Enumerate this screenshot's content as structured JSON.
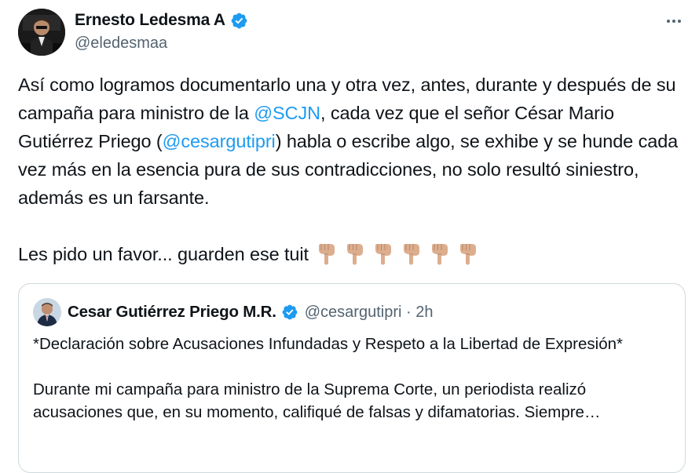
{
  "author": {
    "name": "Ernesto Ledesma A",
    "handle": "@eledesmaa",
    "avatar_icon": "profile-photo",
    "verified_icon": "verified-badge-icon"
  },
  "more_icon": "more-options-icon",
  "tweet": {
    "p1_a": "Así como logramos documentarlo una y otra vez, antes, durante y después de su campaña para ministro de la ",
    "mention1": "@SCJN",
    "p1_b": ", cada vez que el señor César Mario Gutiérrez Priego (",
    "mention2": "@cesargutipri",
    "p1_c": ") habla o escribe algo, se exhibe y se hunde cada vez más en la esencia pura de sus contradicciones, no solo resultó siniestro, además es un farsante.",
    "p2": "Les pido un favor... guarden ese tuit",
    "emoji_count": 6,
    "emoji_icon": "backhand-index-pointing-down-icon"
  },
  "quoted": {
    "name": "Cesar Gutiérrez Priego M.R.",
    "handle_time": "@cesargutipri · 2h",
    "line1": "*Declaración sobre Acusaciones Infundadas y Respeto a la Libertad de Expresión*",
    "line2": "Durante mi campaña para ministro de la Suprema Corte, un periodista realizó acusaciones que, en su momento, califiqué de falsas y difamatorias.",
    "line2_tail": "Siempre…"
  },
  "colors": {
    "link": "#1d9bf0",
    "secondary_text": "#536471",
    "border": "#cfd9de"
  }
}
